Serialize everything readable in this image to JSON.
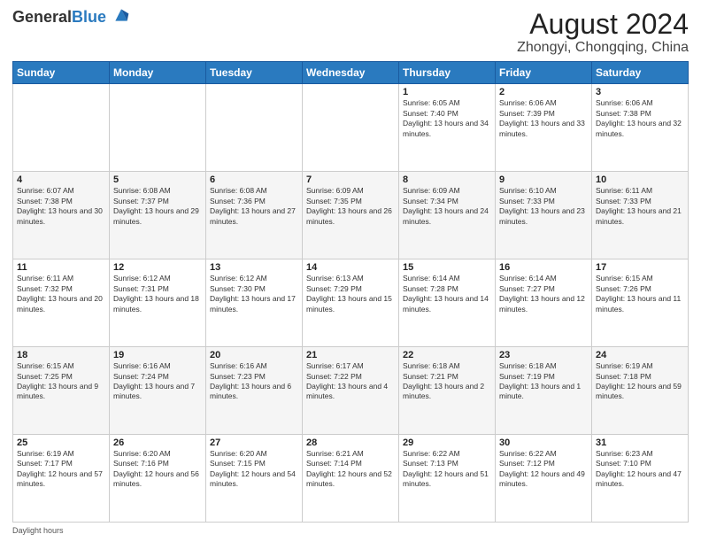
{
  "header": {
    "logo_line1": "General",
    "logo_line2": "Blue",
    "month_year": "August 2024",
    "location": "Zhongyi, Chongqing, China"
  },
  "weekdays": [
    "Sunday",
    "Monday",
    "Tuesday",
    "Wednesday",
    "Thursday",
    "Friday",
    "Saturday"
  ],
  "weeks": [
    [
      {
        "day": "",
        "info": ""
      },
      {
        "day": "",
        "info": ""
      },
      {
        "day": "",
        "info": ""
      },
      {
        "day": "",
        "info": ""
      },
      {
        "day": "1",
        "info": "Sunrise: 6:05 AM\nSunset: 7:40 PM\nDaylight: 13 hours and 34 minutes."
      },
      {
        "day": "2",
        "info": "Sunrise: 6:06 AM\nSunset: 7:39 PM\nDaylight: 13 hours and 33 minutes."
      },
      {
        "day": "3",
        "info": "Sunrise: 6:06 AM\nSunset: 7:38 PM\nDaylight: 13 hours and 32 minutes."
      }
    ],
    [
      {
        "day": "4",
        "info": "Sunrise: 6:07 AM\nSunset: 7:38 PM\nDaylight: 13 hours and 30 minutes."
      },
      {
        "day": "5",
        "info": "Sunrise: 6:08 AM\nSunset: 7:37 PM\nDaylight: 13 hours and 29 minutes."
      },
      {
        "day": "6",
        "info": "Sunrise: 6:08 AM\nSunset: 7:36 PM\nDaylight: 13 hours and 27 minutes."
      },
      {
        "day": "7",
        "info": "Sunrise: 6:09 AM\nSunset: 7:35 PM\nDaylight: 13 hours and 26 minutes."
      },
      {
        "day": "8",
        "info": "Sunrise: 6:09 AM\nSunset: 7:34 PM\nDaylight: 13 hours and 24 minutes."
      },
      {
        "day": "9",
        "info": "Sunrise: 6:10 AM\nSunset: 7:33 PM\nDaylight: 13 hours and 23 minutes."
      },
      {
        "day": "10",
        "info": "Sunrise: 6:11 AM\nSunset: 7:33 PM\nDaylight: 13 hours and 21 minutes."
      }
    ],
    [
      {
        "day": "11",
        "info": "Sunrise: 6:11 AM\nSunset: 7:32 PM\nDaylight: 13 hours and 20 minutes."
      },
      {
        "day": "12",
        "info": "Sunrise: 6:12 AM\nSunset: 7:31 PM\nDaylight: 13 hours and 18 minutes."
      },
      {
        "day": "13",
        "info": "Sunrise: 6:12 AM\nSunset: 7:30 PM\nDaylight: 13 hours and 17 minutes."
      },
      {
        "day": "14",
        "info": "Sunrise: 6:13 AM\nSunset: 7:29 PM\nDaylight: 13 hours and 15 minutes."
      },
      {
        "day": "15",
        "info": "Sunrise: 6:14 AM\nSunset: 7:28 PM\nDaylight: 13 hours and 14 minutes."
      },
      {
        "day": "16",
        "info": "Sunrise: 6:14 AM\nSunset: 7:27 PM\nDaylight: 13 hours and 12 minutes."
      },
      {
        "day": "17",
        "info": "Sunrise: 6:15 AM\nSunset: 7:26 PM\nDaylight: 13 hours and 11 minutes."
      }
    ],
    [
      {
        "day": "18",
        "info": "Sunrise: 6:15 AM\nSunset: 7:25 PM\nDaylight: 13 hours and 9 minutes."
      },
      {
        "day": "19",
        "info": "Sunrise: 6:16 AM\nSunset: 7:24 PM\nDaylight: 13 hours and 7 minutes."
      },
      {
        "day": "20",
        "info": "Sunrise: 6:16 AM\nSunset: 7:23 PM\nDaylight: 13 hours and 6 minutes."
      },
      {
        "day": "21",
        "info": "Sunrise: 6:17 AM\nSunset: 7:22 PM\nDaylight: 13 hours and 4 minutes."
      },
      {
        "day": "22",
        "info": "Sunrise: 6:18 AM\nSunset: 7:21 PM\nDaylight: 13 hours and 2 minutes."
      },
      {
        "day": "23",
        "info": "Sunrise: 6:18 AM\nSunset: 7:19 PM\nDaylight: 13 hours and 1 minute."
      },
      {
        "day": "24",
        "info": "Sunrise: 6:19 AM\nSunset: 7:18 PM\nDaylight: 12 hours and 59 minutes."
      }
    ],
    [
      {
        "day": "25",
        "info": "Sunrise: 6:19 AM\nSunset: 7:17 PM\nDaylight: 12 hours and 57 minutes."
      },
      {
        "day": "26",
        "info": "Sunrise: 6:20 AM\nSunset: 7:16 PM\nDaylight: 12 hours and 56 minutes."
      },
      {
        "day": "27",
        "info": "Sunrise: 6:20 AM\nSunset: 7:15 PM\nDaylight: 12 hours and 54 minutes."
      },
      {
        "day": "28",
        "info": "Sunrise: 6:21 AM\nSunset: 7:14 PM\nDaylight: 12 hours and 52 minutes."
      },
      {
        "day": "29",
        "info": "Sunrise: 6:22 AM\nSunset: 7:13 PM\nDaylight: 12 hours and 51 minutes."
      },
      {
        "day": "30",
        "info": "Sunrise: 6:22 AM\nSunset: 7:12 PM\nDaylight: 12 hours and 49 minutes."
      },
      {
        "day": "31",
        "info": "Sunrise: 6:23 AM\nSunset: 7:10 PM\nDaylight: 12 hours and 47 minutes."
      }
    ]
  ],
  "footer": {
    "note": "Daylight hours"
  },
  "colors": {
    "header_bg": "#2a7abf",
    "logo_blue": "#2a7abf"
  }
}
